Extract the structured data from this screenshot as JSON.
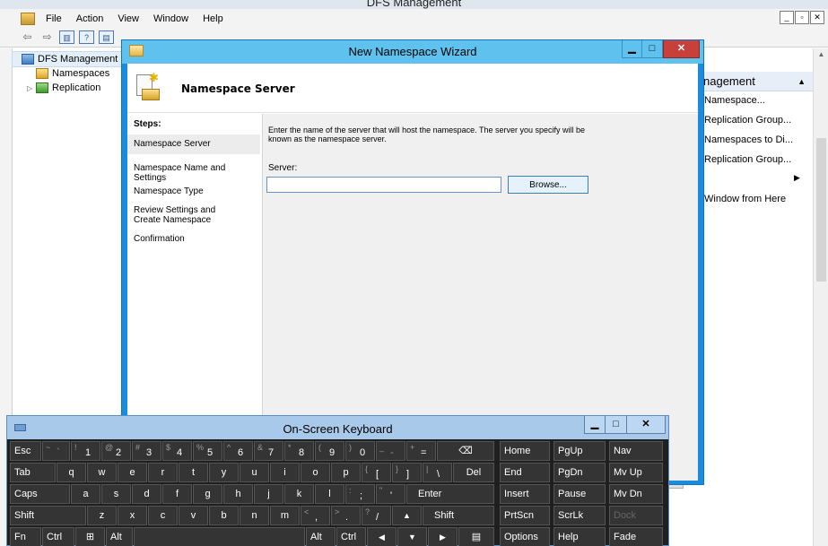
{
  "mmc": {
    "title": "DFS Management",
    "menu": [
      "File",
      "Action",
      "View",
      "Window",
      "Help"
    ],
    "tree": {
      "root": "DFS Management",
      "items": [
        "Namespaces",
        "Replication"
      ]
    },
    "actions": {
      "header": "nagement",
      "items": [
        "Namespace...",
        "Replication Group...",
        "Namespaces to Di...",
        "Replication Group...",
        "Window from Here"
      ]
    }
  },
  "wizard": {
    "title": "New Namespace Wizard",
    "header_title": "Namespace Server",
    "steps_heading": "Steps:",
    "steps": [
      "Namespace Server",
      "Namespace Name and Settings",
      "Namespace Type",
      "Review Settings and Create Namespace",
      "Confirmation"
    ],
    "current_step": "Namespace Server",
    "description": "Enter the name of the server that will host the namespace. The server you specify will be known as the namespace server.",
    "server_label": "Server:",
    "server_value": "",
    "browse_label": "Browse..."
  },
  "osk": {
    "title": "On-Screen Keyboard",
    "rows": {
      "r1": {
        "esc": "Esc",
        "num": [
          {
            "shift": "~",
            "main": "`"
          },
          {
            "shift": "!",
            "main": "1"
          },
          {
            "shift": "@",
            "main": "2"
          },
          {
            "shift": "#",
            "main": "3"
          },
          {
            "shift": "$",
            "main": "4"
          },
          {
            "shift": "%",
            "main": "5"
          },
          {
            "shift": "^",
            "main": "6"
          },
          {
            "shift": "&",
            "main": "7"
          },
          {
            "shift": "*",
            "main": "8"
          },
          {
            "shift": "(",
            "main": "9"
          },
          {
            "shift": ")",
            "main": "0"
          },
          {
            "shift": "_",
            "main": "-"
          },
          {
            "shift": "+",
            "main": "="
          }
        ],
        "backspace": "⌫",
        "nav": [
          "Home",
          "PgUp",
          "Nav"
        ]
      },
      "r2": {
        "tab": "Tab",
        "letters": [
          "q",
          "w",
          "e",
          "r",
          "t",
          "y",
          "u",
          "i",
          "o",
          "p"
        ],
        "brackets": [
          {
            "shift": "{",
            "main": "["
          },
          {
            "shift": "}",
            "main": "]"
          },
          {
            "shift": "|",
            "main": "\\"
          }
        ],
        "del": "Del",
        "nav": [
          "End",
          "PgDn",
          "Mv Up"
        ]
      },
      "r3": {
        "caps": "Caps",
        "letters": [
          "a",
          "s",
          "d",
          "f",
          "g",
          "h",
          "j",
          "k",
          "l"
        ],
        "punct": [
          {
            "shift": ":",
            "main": ";"
          },
          {
            "shift": "\"",
            "main": "'"
          }
        ],
        "enter": "Enter",
        "nav": [
          "Insert",
          "Pause",
          "Mv Dn"
        ]
      },
      "r4": {
        "shift": "Shift",
        "letters": [
          "z",
          "x",
          "c",
          "v",
          "b",
          "n",
          "m"
        ],
        "punct": [
          {
            "shift": "<",
            "main": ","
          },
          {
            "shift": ">",
            "main": "."
          },
          {
            "shift": "?",
            "main": "/"
          }
        ],
        "up": "▲",
        "shift_right": "Shift",
        "nav": [
          "PrtScn",
          "ScrLk",
          "Dock"
        ]
      },
      "r5": {
        "fn": "Fn",
        "ctrl": "Ctrl",
        "win": "⊞",
        "alt": "Alt",
        "alt_right": "Alt",
        "ctrl_right": "Ctrl",
        "left": "◀",
        "down": "▼",
        "right": "▶",
        "menu": "▤",
        "nav": [
          "Options",
          "Help",
          "Fade"
        ]
      }
    }
  }
}
